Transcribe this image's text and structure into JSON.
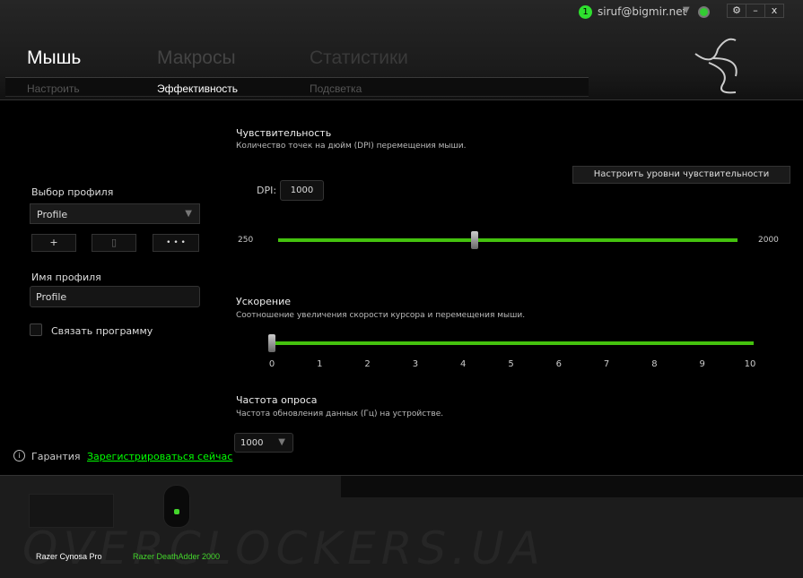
{
  "titlebar": {
    "notification_count": "1",
    "user": "siruf@bigmir.net",
    "settings_icon": "gear-icon",
    "minimize": "–",
    "close": "x"
  },
  "tabs": [
    {
      "label": "Мышь",
      "active": true
    },
    {
      "label": "Макросы",
      "active": false
    },
    {
      "label": "Статистики",
      "active": false
    }
  ],
  "subtabs": [
    {
      "label": "Настроить",
      "active": false
    },
    {
      "label": "Эффективность",
      "active": true
    },
    {
      "label": "Подсветка",
      "active": false
    }
  ],
  "profile": {
    "label": "Выбор профиля",
    "selected": "Profile",
    "add": "+",
    "delete_icon": "trash-icon",
    "more": "• • •",
    "name_label": "Имя профиля",
    "name_value": "Profile",
    "link_program": "Связать программу",
    "link_checked": false
  },
  "sensitivity": {
    "title": "Чувствительность",
    "desc": "Количество точек на дюйм (DPI) перемещения мыши.",
    "configure_button": "Настроить уровни чувствительности",
    "dpi_label": "DPI:",
    "dpi_value": "1000",
    "min": "250",
    "max": "2000",
    "value": 1000
  },
  "acceleration": {
    "title": "Ускорение",
    "desc": "Соотношение увеличения скорости курсора и перемещения мыши.",
    "ticks": [
      "0",
      "1",
      "2",
      "3",
      "4",
      "5",
      "6",
      "7",
      "8",
      "9",
      "10"
    ],
    "value": 0
  },
  "polling": {
    "title": "Частота опроса",
    "desc": "Частота обновления данных (Гц) на устройстве.",
    "value": "1000"
  },
  "warranty": {
    "label": "Гарантия",
    "register_link": "Зарегистрироваться сейчас"
  },
  "devices": [
    {
      "name": "Razer Cynosa Pro",
      "active": false
    },
    {
      "name": "Razer DeathAdder 2000",
      "active": true
    }
  ],
  "watermark": "OVERCLOCKERS.UA",
  "colors": {
    "accent": "#44d62c",
    "link": "#00ff00"
  }
}
